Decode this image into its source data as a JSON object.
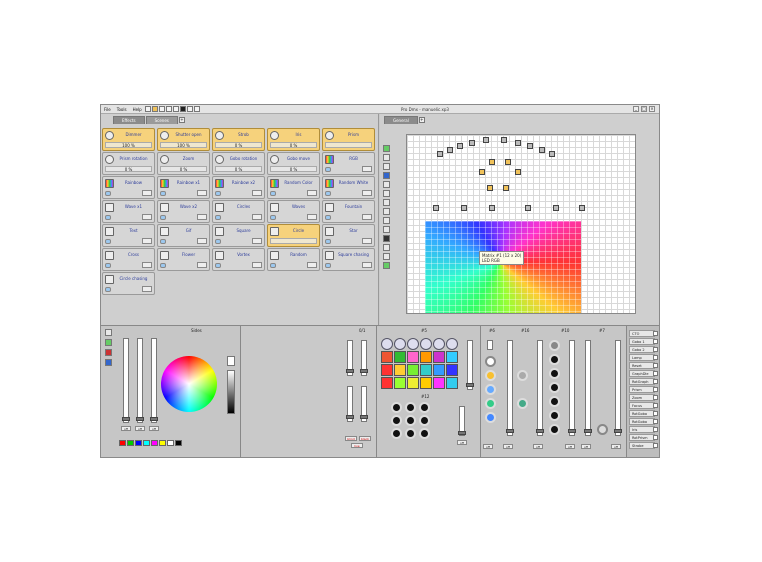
{
  "window": {
    "title": "Pro Dmx - manuelic.xp3"
  },
  "menu": {
    "file": "File",
    "tools": "Tools",
    "help": "Help"
  },
  "left_tabs": {
    "effects": "Effects",
    "scenes": "Scenes",
    "add": "+"
  },
  "right_tabs": {
    "general": "General",
    "add": "+"
  },
  "effects": [
    {
      "name": "Dimmer",
      "value": "100 %",
      "on": true
    },
    {
      "name": "Shutter open",
      "value": "100 %",
      "on": true
    },
    {
      "name": "Strob",
      "value": "0 %",
      "on": true
    },
    {
      "name": "Iris",
      "value": "0 %",
      "on": true
    },
    {
      "name": "Prism",
      "value": "",
      "on": true
    },
    {
      "name": "Prism rotation",
      "value": "0 %",
      "on": false
    },
    {
      "name": "Zoom",
      "value": "0 %",
      "on": false
    },
    {
      "name": "Gobo rotation",
      "value": "0 %",
      "on": false
    },
    {
      "name": "Gobo move",
      "value": "0 %",
      "on": false
    },
    {
      "name": "RGB",
      "value": "",
      "on": false
    },
    {
      "name": "Rainbow",
      "value": "",
      "on": false
    },
    {
      "name": "Rainbow x1",
      "value": "",
      "on": false
    },
    {
      "name": "Rainbow x2",
      "value": "",
      "on": false
    },
    {
      "name": "Random Color",
      "value": "",
      "on": false
    },
    {
      "name": "Random White",
      "value": "",
      "on": false
    },
    {
      "name": "Wave x1",
      "value": "",
      "on": false
    },
    {
      "name": "Wave x2",
      "value": "",
      "on": false
    },
    {
      "name": "Circles",
      "value": "",
      "on": false
    },
    {
      "name": "Waves",
      "value": "",
      "on": false
    },
    {
      "name": "Fountain",
      "value": "",
      "on": false
    },
    {
      "name": "Text",
      "value": "",
      "on": false
    },
    {
      "name": "Gif",
      "value": "",
      "on": false
    },
    {
      "name": "Square",
      "value": "",
      "on": false
    },
    {
      "name": "Circle",
      "value": "",
      "on": true
    },
    {
      "name": "Star",
      "value": "",
      "on": false
    },
    {
      "name": "Cross",
      "value": "",
      "on": false
    },
    {
      "name": "Flower",
      "value": "",
      "on": false
    },
    {
      "name": "Vortex",
      "value": "",
      "on": false
    },
    {
      "name": "Random",
      "value": "",
      "on": false
    },
    {
      "name": "Square chasing",
      "value": "",
      "on": false
    },
    {
      "name": "Circle chasing",
      "value": "",
      "on": false
    }
  ],
  "matrix_tooltip": {
    "line1": "Matrix #1 (12 x 20)",
    "line2": "LED RGB"
  },
  "bottom": {
    "section_label": "Sides",
    "xy_label": "0/1",
    "group5": "#5",
    "group6": "#6",
    "group16": "#16",
    "group10": "#10",
    "group7": "#7",
    "group12": "#12",
    "off": "off",
    "blind": "blind",
    "black": "black",
    "live": "live"
  },
  "properties": [
    "CTO",
    "Gobo 1",
    "Gobo 2",
    "Lamp",
    "Reset",
    "GraphDle",
    "RotGraph",
    "Prism",
    "Zoom",
    "Focus",
    "RotGobo",
    "RotGobo",
    "Iris",
    "RotPrism",
    "Strobe"
  ],
  "palette": [
    "#ff0000",
    "#00cc00",
    "#0000ff",
    "#00ffff",
    "#ff00ff",
    "#ffff00",
    "#ffffff",
    "#000000"
  ],
  "gobo_colors": [
    "#e53",
    "#3b3",
    "#f6c",
    "#f90",
    "#c3c",
    "#3cf",
    "#f33",
    "#fc3",
    "#7e3",
    "#3cc",
    "#39f",
    "#33f",
    "#f33",
    "#9f3",
    "#ee3",
    "#fc0",
    "#f3f",
    "#3ce"
  ]
}
